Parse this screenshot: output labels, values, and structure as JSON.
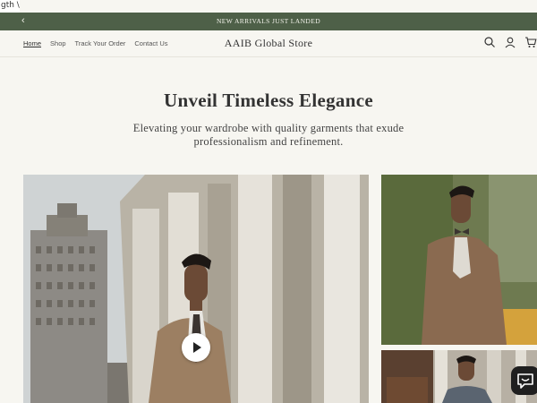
{
  "stray_text": "gth \\",
  "announcement": {
    "text": "NEW ARRIVALS JUST LANDED",
    "prev_icon": "chevron-left-icon"
  },
  "header": {
    "brand": "AAIB Global Store",
    "nav": [
      {
        "label": "Home",
        "active": true
      },
      {
        "label": "Shop",
        "active": false
      },
      {
        "label": "Track Your Order",
        "active": false
      },
      {
        "label": "Contact Us",
        "active": false
      }
    ],
    "icons": [
      "search-icon",
      "account-icon",
      "cart-icon"
    ]
  },
  "hero": {
    "title": "Unveil Timeless Elegance",
    "subtitle": "Elevating your wardrobe with quality garments that exude professionalism and refinement."
  },
  "colors": {
    "announcement_bg": "#4e6048",
    "page_bg": "#f7f6f1",
    "chat_bg": "#1f1f1f"
  }
}
